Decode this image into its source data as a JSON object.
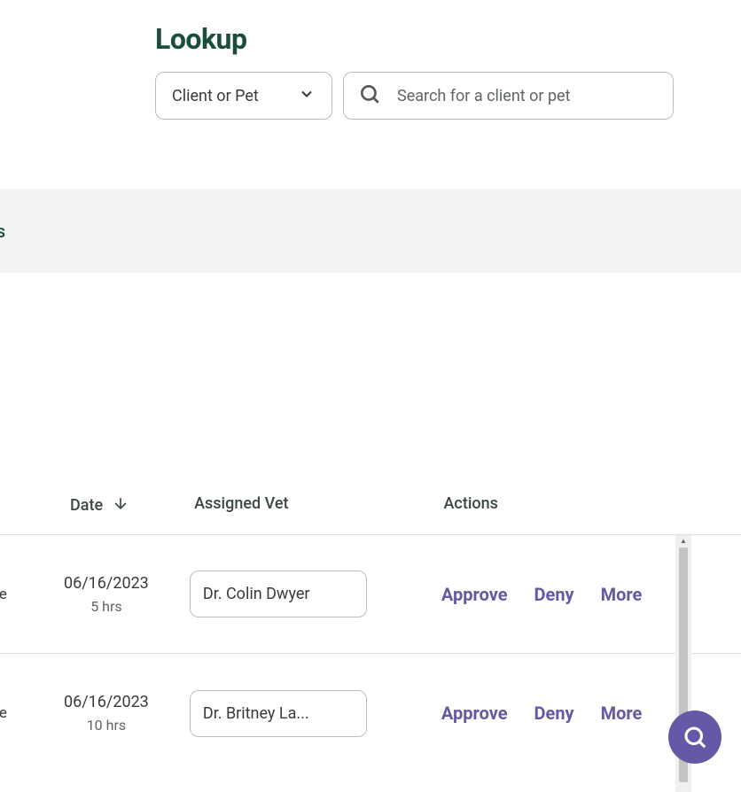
{
  "lookup": {
    "title": "Lookup",
    "dropdown_label": "Client or Pet",
    "search_placeholder": "Search for a client or pet"
  },
  "tabs": {
    "partial": "ments"
  },
  "columns": {
    "date": "Date",
    "assigned_vet": "Assigned Vet",
    "actions": "Actions"
  },
  "rows": [
    {
      "left_partial": "ce",
      "date": "06/16/2023",
      "hours": "5 hrs",
      "vet": "Dr. Colin Dwyer"
    },
    {
      "left_partial": "ce",
      "date": "06/16/2023",
      "hours": "10 hrs",
      "vet": "Dr. Britney La..."
    }
  ],
  "actions": {
    "approve": "Approve",
    "deny": "Deny",
    "more": "More"
  }
}
